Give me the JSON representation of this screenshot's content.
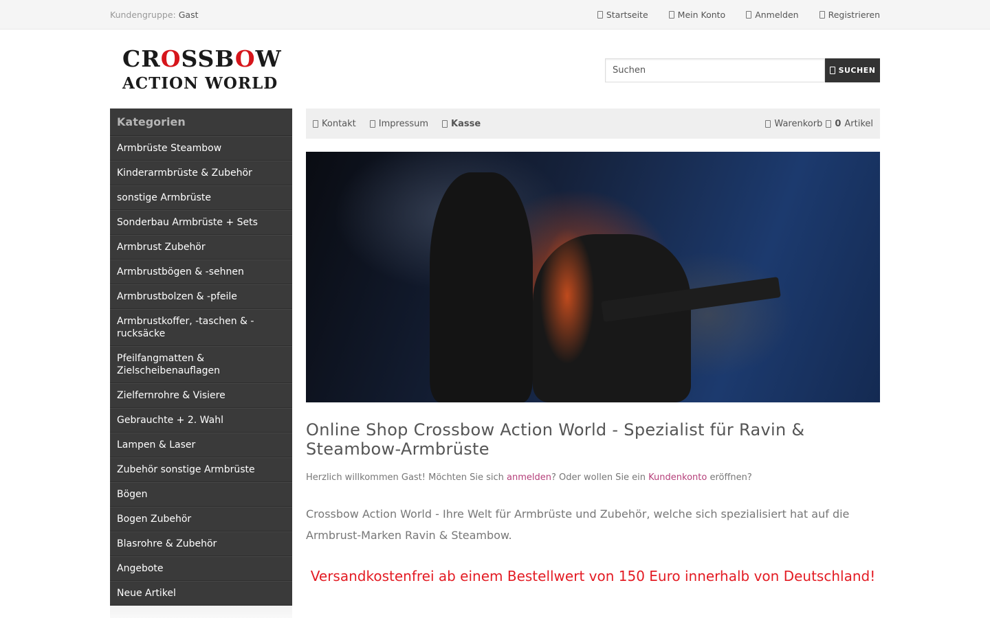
{
  "topbar": {
    "customer_group_label": "Kundengruppe:",
    "customer_group_value": "Gast",
    "nav": [
      "Startseite",
      "Mein Konto",
      "Anmelden",
      "Registrieren"
    ]
  },
  "header": {
    "logo_line1_a": "CR",
    "logo_line1_o1": "O",
    "logo_line1_b": "SSB",
    "logo_line1_o2": "O",
    "logo_line1_c": "W",
    "logo_line2": "ACTION WORLD",
    "search_placeholder": "Suchen",
    "search_button": "SUCHEN"
  },
  "sidebar": {
    "title": "Kategorien",
    "items": [
      "Armbrüste Steambow",
      "Kinderarmbrüste & Zubehör",
      "sonstige Armbrüste",
      "Sonderbau Armbrüste + Sets",
      "Armbrust Zubehör",
      "Armbrustbögen & -sehnen",
      "Armbrustbolzen & -pfeile",
      "Armbrustkoffer, -taschen & -rucksäcke",
      "Pfeilfangmatten & Zielscheibenauflagen",
      "Zielfernrohre & Visiere",
      "Gebrauchte + 2. Wahl",
      "Lampen & Laser",
      "Zubehör sonstige Armbrüste",
      "Bögen",
      "Bogen Zubehör",
      "Blasrohre & Zubehör",
      "Angebote",
      "Neue Artikel"
    ]
  },
  "subnav": {
    "contact": "Kontakt",
    "imprint": "Impressum",
    "checkout": "Kasse",
    "cart": "Warenkorb",
    "cart_count": "0",
    "cart_items_label": "Artikel"
  },
  "main": {
    "title": "Online Shop Crossbow Action World - Spezialist für Ravin & Steambow-Armbrüste",
    "welcome_prefix": "Herzlich willkommen Gast! Möchten Sie sich ",
    "welcome_login": "anmelden",
    "welcome_middle": "? Oder wollen Sie ein ",
    "welcome_account": "Kundenkonto",
    "welcome_suffix": " eröffnen?",
    "intro": "Crossbow Action World - Ihre Welt für Armbrüste und Zubehör, welche sich spezialisiert hat auf die Armbrust-Marken Ravin & Steambow.",
    "shipping": "Versandkostenfrei ab einem Bestellwert von 150 Euro innerhalb von Deutschland!"
  },
  "colors": {
    "accent_red": "#e31b23",
    "link_pink": "#b5407a",
    "sidebar_bg": "#3a3a3a"
  }
}
